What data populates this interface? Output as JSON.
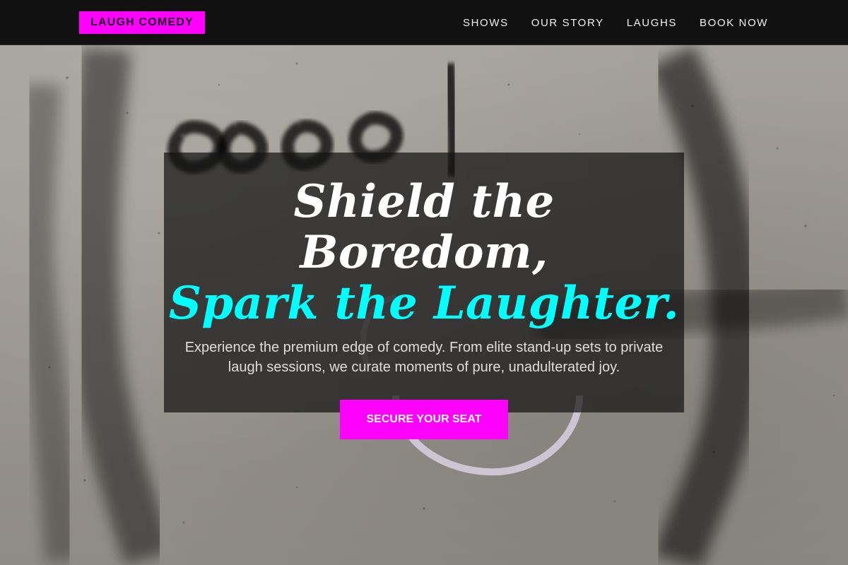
{
  "header": {
    "brand": "LAUGH COMEDY",
    "nav": [
      {
        "label": "SHOWS"
      },
      {
        "label": "OUR STORY"
      },
      {
        "label": "LAUGHS"
      },
      {
        "label": "BOOK NOW"
      }
    ]
  },
  "hero": {
    "headline_line1": "Shield the Boredom,",
    "headline_line2": "Spark the Laughter.",
    "subtitle": "Experience the premium edge of comedy. From elite stand-up sets to private laugh sessions, we curate moments of pure, unadulterated joy.",
    "cta_label": "SECURE YOUR SEAT",
    "background_icon": "graffiti-wall-image"
  },
  "colors": {
    "header_bg": "#111111",
    "accent_magenta": "#ff00ff",
    "accent_cyan": "#00ffff",
    "card_bg": "#141414"
  }
}
